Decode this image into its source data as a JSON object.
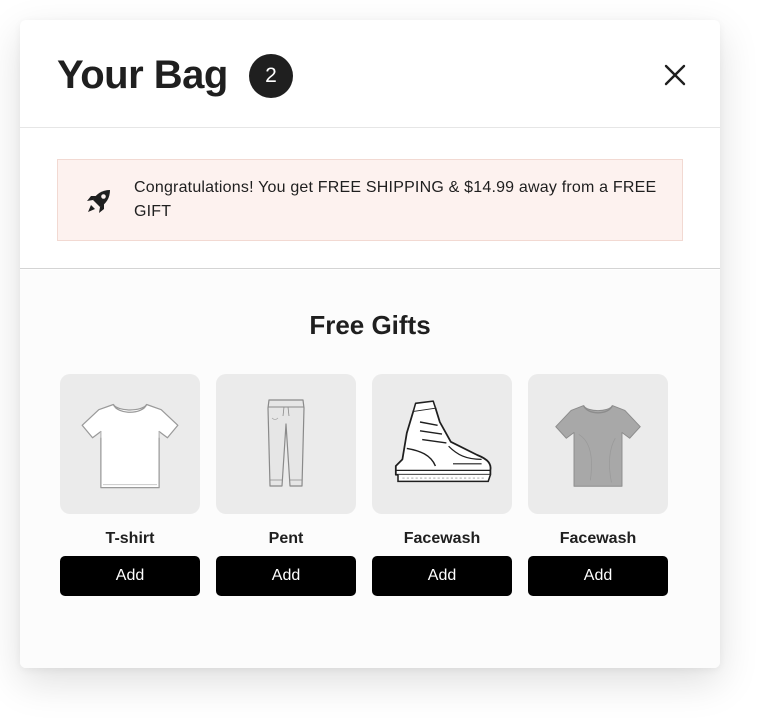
{
  "header": {
    "title": "Your Bag",
    "item_count": "2"
  },
  "banner": {
    "message": "Congratulations! You get FREE SHIPPING & $14.99 away from a FREE GIFT",
    "icon": "rocket-icon"
  },
  "gifts": {
    "title": "Free Gifts",
    "items": [
      {
        "name": "T-shirt",
        "button": "Add",
        "image": "white-tshirt"
      },
      {
        "name": "Pent",
        "button": "Add",
        "image": "grey-pants"
      },
      {
        "name": "Facewash",
        "button": "Add",
        "image": "sneaker"
      },
      {
        "name": "Facewash",
        "button": "Add",
        "image": "grey-tshirt"
      }
    ]
  },
  "colors": {
    "banner_bg": "#fdf2ef",
    "banner_border": "#f2d9d2",
    "button_bg": "#000000",
    "badge_bg": "#1f1f1f"
  }
}
